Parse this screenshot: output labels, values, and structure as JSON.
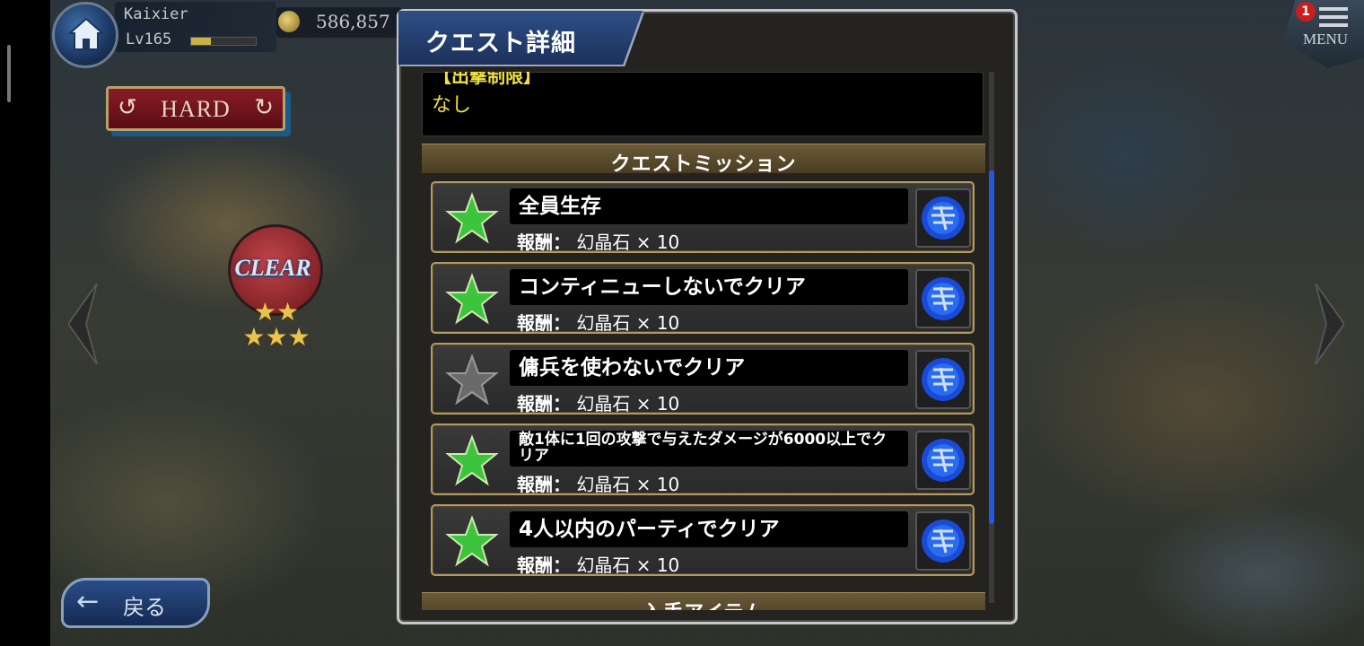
{
  "player": {
    "name": "Kaixier",
    "level": "Lv165",
    "exp_fraction": 0.3,
    "gil": "586,857"
  },
  "difficulty": {
    "label": "HARD"
  },
  "map_node": {
    "label": "CLEAR",
    "stars": "★★\n★★★"
  },
  "back_button": {
    "label": "戻る"
  },
  "menu": {
    "label": "MENU",
    "badge": "1"
  },
  "dialog": {
    "title": "クエスト詳細",
    "restriction": {
      "heading": "【出撃制限】",
      "value": "なし"
    },
    "missions_header": "クエストミッション",
    "missions": [
      {
        "name": "全員生存",
        "reward_label": "報酬：",
        "reward": "幻晶石 × 10",
        "achieved": true
      },
      {
        "name": "コンティニューしないでクリア",
        "reward_label": "報酬：",
        "reward": "幻晶石 × 10",
        "achieved": true
      },
      {
        "name": "傭兵を使わないでクリア",
        "reward_label": "報酬：",
        "reward": "幻晶石 × 10",
        "achieved": false
      },
      {
        "name": "敵1体に1回の攻撃で与えたダメージが6000以上でクリア",
        "reward_label": "報酬：",
        "reward": "幻晶石 × 10",
        "achieved": true
      },
      {
        "name": "4人以内のパーティでクリア",
        "reward_label": "報酬：",
        "reward": "幻晶石 × 10",
        "achieved": true
      }
    ],
    "next_section_header": "入手アイテム"
  },
  "colors": {
    "accent_gold": "#b19b64",
    "title_blue": "#2e4f86",
    "restriction_yellow": "#f0e040",
    "star_achieved": "#3cc43c",
    "star_unachieved": "#6a6a6a",
    "scroll_thumb": "#2458e0"
  }
}
